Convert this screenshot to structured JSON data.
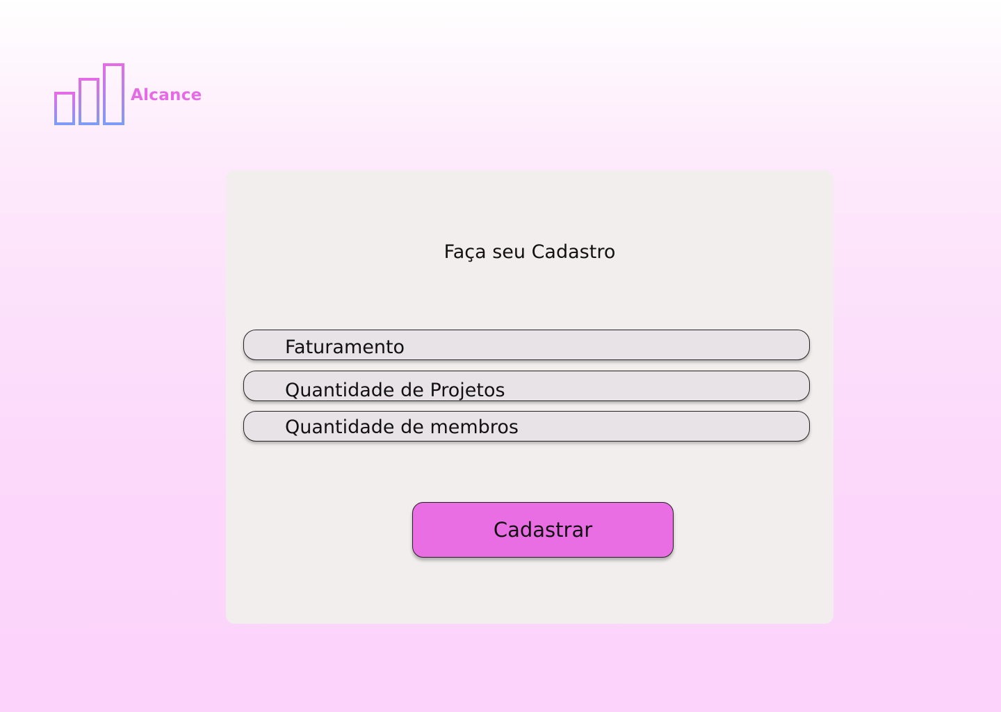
{
  "brand": {
    "name": "Alcance",
    "logo_icon": "bar-chart-logo-icon",
    "colors": {
      "primary": "#e56be6",
      "secondary": "#7e9bf6"
    }
  },
  "form": {
    "title": "Faça seu Cadastro",
    "fields": [
      {
        "placeholder": "Faturamento"
      },
      {
        "placeholder": "Quantidade de Projetos"
      },
      {
        "placeholder": "Quantidade de membros"
      }
    ],
    "submit_label": "Cadastrar",
    "submit_color": "#e96ee3"
  }
}
